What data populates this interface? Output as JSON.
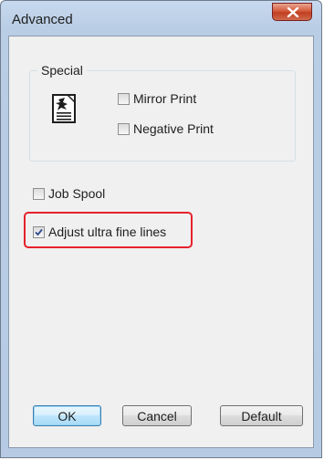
{
  "window": {
    "title": "Advanced"
  },
  "special_group": {
    "label": "Special",
    "mirror_print": {
      "label": "Mirror Print",
      "checked": false
    },
    "negative_print": {
      "label": "Negative Print",
      "checked": false
    }
  },
  "job_spool": {
    "label": "Job Spool",
    "checked": false
  },
  "adjust_lines": {
    "label": "Adjust ultra fine lines",
    "checked": true
  },
  "buttons": {
    "ok": "OK",
    "cancel": "Cancel",
    "default": "Default"
  },
  "colors": {
    "highlight": "#e5222b",
    "close_button": "#c23e20"
  },
  "icons": {
    "close": "close-icon",
    "document": "printer-document-icon",
    "check": "checkmark-icon"
  }
}
